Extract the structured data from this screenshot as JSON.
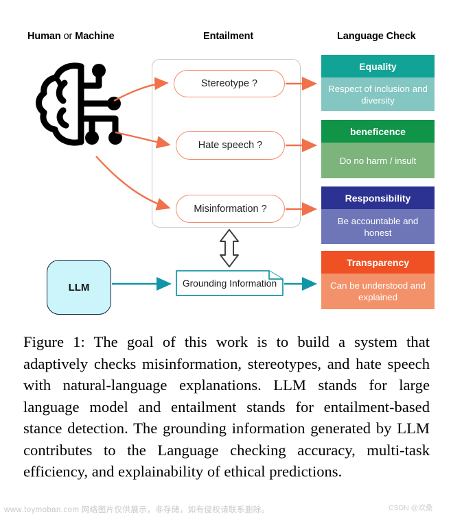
{
  "figure": {
    "columns": [
      {
        "id": "human-or-machine",
        "prefix": "Human",
        "middle": " or ",
        "suffix": "Machine"
      },
      {
        "id": "entailment",
        "label": "Entailment"
      },
      {
        "id": "language-check",
        "label": "Language Check"
      }
    ],
    "source_icon": "brain-circuit-icon",
    "entailment": {
      "items": [
        {
          "id": "stereotype",
          "label": "Stereotype ?"
        },
        {
          "id": "hate-speech",
          "label": "Hate speech ?"
        },
        {
          "id": "misinformation",
          "label": "Misinformation ?"
        }
      ]
    },
    "language_check": {
      "items": [
        {
          "id": "equality",
          "title": "Equality",
          "body": "Respect of inclusion and diversity",
          "title_color": "#11a396",
          "body_color": "#84c6c1"
        },
        {
          "id": "beneficence",
          "title": "beneficence",
          "body": "Do no harm / insult",
          "title_color": "#0f9448",
          "body_color": "#7cb47c"
        },
        {
          "id": "responsibility",
          "title": "Responsibility",
          "body": "Be accountable and honest",
          "title_color": "#2c3292",
          "body_color": "#6f76b8"
        },
        {
          "id": "transparency",
          "title": "Transparency",
          "body": "Can be understood and explained",
          "title_color": "#ef5124",
          "body_color": "#f3926a"
        }
      ]
    },
    "llm": {
      "label": "LLM"
    },
    "grounding": {
      "label": "Grounding Information"
    },
    "colors": {
      "arrow_orange": "#f0714a",
      "arrow_teal": "#1195a8",
      "pill_border": "#f58a67",
      "container_border": "#c9c9c9",
      "llm_fill": "#ccf5fb",
      "llm_border": "#16213b",
      "doc_border": "#1195a8"
    },
    "bidirectional_arrow": "double-headed-vertical-arrow"
  },
  "caption": {
    "text": "Figure 1: The goal of this work is to build a system that adaptively checks misinformation, stereotypes, and hate speech with natural-language explanations. LLM stands for large language model and entailment stands for entailment-based stance detection. The grounding information generated by LLM contributes to the Language checking accuracy, multi-task efficiency, and explainability of ethical predictions."
  },
  "watermark": {
    "left": "www.toymoban.com 网络图片仅供展示，非存储，如有侵权请联系删除。",
    "right": "CSDN @欢桑"
  }
}
